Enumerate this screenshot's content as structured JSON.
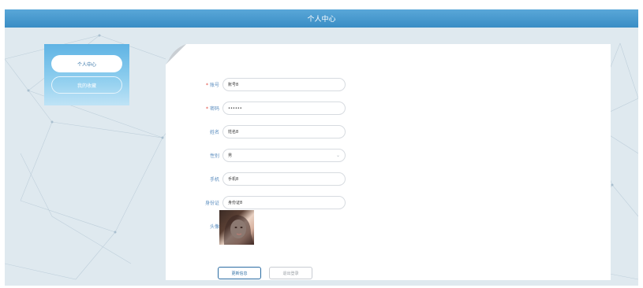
{
  "header": {
    "title": "个人中心"
  },
  "sidebar": {
    "items": [
      {
        "label": "个人中心"
      },
      {
        "label": "我的收藏"
      }
    ]
  },
  "form": {
    "account": {
      "label": "账号",
      "value": "账号8"
    },
    "password": {
      "label": "密码",
      "value": "••••••"
    },
    "name": {
      "label": "姓名",
      "value": "姓名8"
    },
    "gender": {
      "label": "性别",
      "value": "男"
    },
    "phone": {
      "label": "手机",
      "value": "手机8"
    },
    "idcard": {
      "label": "身份证",
      "value": "身份证8"
    },
    "avatar": {
      "label": "头像"
    },
    "required_mark": "*"
  },
  "buttons": {
    "update": "更新信息",
    "logout": "退出登录"
  },
  "colors": {
    "header": "#3a8dc5",
    "label": "#5b8dbf",
    "required": "#e0463d",
    "primary": "#2b6da3"
  }
}
